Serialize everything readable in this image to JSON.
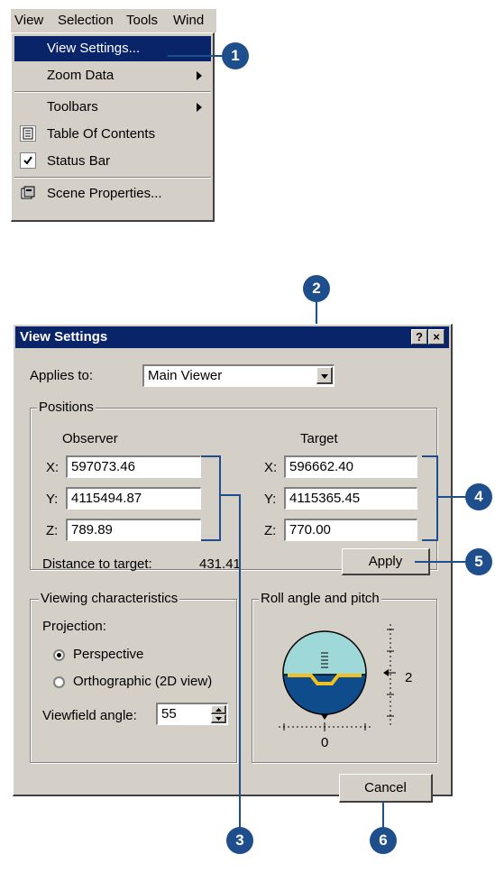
{
  "menubar": {
    "items": [
      "View",
      "Selection",
      "Tools",
      "Wind"
    ]
  },
  "view_menu": {
    "items": [
      {
        "label": "View Settings...",
        "selected": true,
        "submenu": false
      },
      {
        "label": "Zoom Data",
        "submenu": true
      },
      {
        "label": "Toolbars",
        "submenu": true
      },
      {
        "label": "Table Of Contents",
        "icon": "table-of-contents-icon",
        "checked": true
      },
      {
        "label": "Status Bar",
        "icon": "checkmark-icon",
        "checked": true
      },
      {
        "label": "Scene Properties...",
        "icon": "scene-properties-icon"
      }
    ]
  },
  "callouts": [
    "1",
    "2",
    "3",
    "4",
    "5",
    "6"
  ],
  "dialog": {
    "title": "View Settings",
    "help_btn": "?",
    "close_btn": "×",
    "applies_to_label": "Applies to:",
    "applies_to_value": "Main Viewer",
    "positions": {
      "title": "Positions",
      "observer_label": "Observer",
      "target_label": "Target",
      "observer": {
        "x_label": "X:",
        "x": "597073.46",
        "y_label": "Y:",
        "y": "4115494.87",
        "z_label": "Z:",
        "z": "789.89"
      },
      "target": {
        "x_label": "X:",
        "x": "596662.40",
        "y_label": "Y:",
        "y": "4115365.45",
        "z_label": "Z:",
        "z": "770.00"
      },
      "distance_label": "Distance to target:",
      "distance_value": "431.41",
      "apply_button": "Apply"
    },
    "viewing": {
      "title": "Viewing characteristics",
      "projection_label": "Projection:",
      "perspective_label": "Perspective",
      "orthographic_label": "Orthographic (2D view)",
      "projection_selected": "Perspective",
      "viewfield_label": "Viewfield angle:",
      "viewfield_value": "55"
    },
    "roll_pitch": {
      "title": "Roll angle and pitch",
      "pitch_value": "2",
      "roll_value": "0"
    },
    "cancel_button": "Cancel"
  },
  "colors": {
    "accent": "#1f4e8c",
    "titlebar": "#0a246a",
    "sky": "#9fd8d8",
    "ground": "#0f4c8c",
    "horizon": "#f0c020"
  }
}
